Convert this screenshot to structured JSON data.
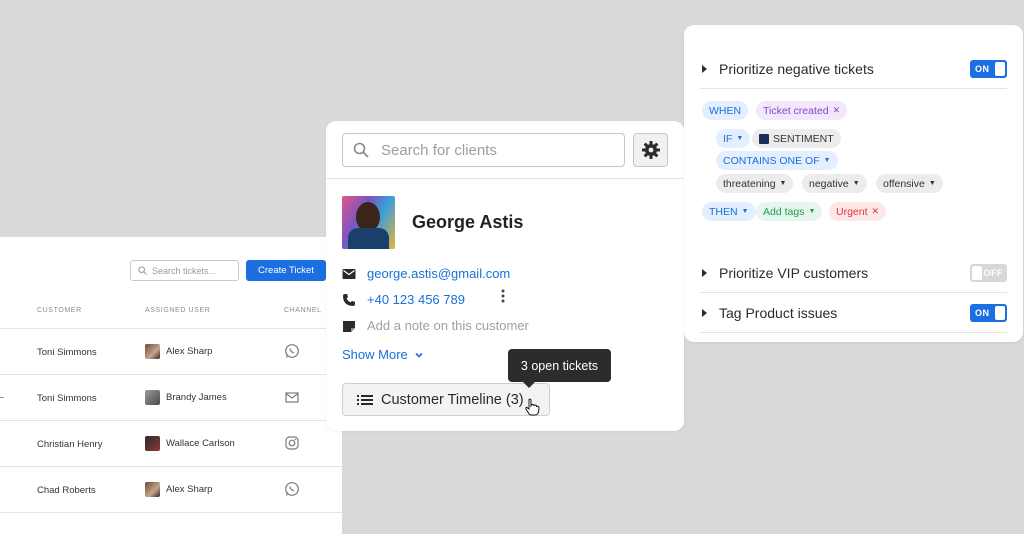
{
  "tickets": {
    "search_placeholder": "Search tickets...",
    "create_label": "Create Ticket",
    "columns": {
      "customer": "CUSTOMER",
      "assigned": "ASSIGNED USER",
      "channel": "CHANNEL"
    },
    "rows": [
      {
        "customer": "Toni Simmons",
        "user": "Alex Sharp",
        "channel_icon": "whatsapp-icon"
      },
      {
        "customer": "Toni Simmons",
        "user": "Brandy James",
        "channel_icon": "mail-icon"
      },
      {
        "customer": "Christian Henry",
        "user": "Wallace Carlson",
        "channel_icon": "instagram-icon"
      },
      {
        "customer": "Chad Roberts",
        "user": "Alex Sharp",
        "channel_icon": "whatsapp-icon"
      }
    ]
  },
  "client": {
    "search_placeholder": "Search for clients",
    "name": "George Astis",
    "email": "george.astis@gmail.com",
    "phone": "+40 123 456 789",
    "note_placeholder": "Add a note on this customer",
    "show_more": "Show More",
    "timeline_label": "Customer Timeline (3)",
    "tooltip": "3 open tickets"
  },
  "rules": {
    "items": [
      {
        "title": "Prioritize negative tickets",
        "toggle": "ON"
      },
      {
        "title": "Prioritize VIP customers",
        "toggle": "OFF"
      },
      {
        "title": "Tag Product issues",
        "toggle": "ON"
      }
    ],
    "chips": {
      "when": "WHEN",
      "trigger": "Ticket created",
      "if": "IF",
      "sentiment": "SENTIMENT",
      "contains": "CONTAINS ONE OF",
      "word1": "threatening",
      "word2": "negative",
      "word3": "offensive",
      "then": "THEN",
      "action": "Add tags",
      "tag": "Urgent"
    }
  },
  "colors": {
    "accent": "#1b6fe0",
    "background": "#d9d9d9"
  }
}
